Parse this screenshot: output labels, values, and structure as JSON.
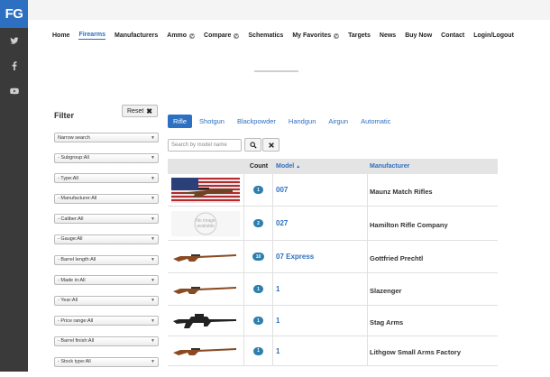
{
  "logo": "FG",
  "social": [
    "twitter-icon",
    "facebook-icon",
    "youtube-icon"
  ],
  "nav": [
    {
      "label": "Home",
      "dropdown": false,
      "active": false
    },
    {
      "label": "Firearms",
      "dropdown": false,
      "active": true
    },
    {
      "label": "Manufacturers",
      "dropdown": false,
      "active": false
    },
    {
      "label": "Ammo",
      "dropdown": true,
      "active": false
    },
    {
      "label": "Compare",
      "dropdown": true,
      "active": false
    },
    {
      "label": "Schematics",
      "dropdown": false,
      "active": false
    },
    {
      "label": "My Favorites",
      "dropdown": true,
      "active": false
    },
    {
      "label": "Targets",
      "dropdown": false,
      "active": false
    },
    {
      "label": "News",
      "dropdown": false,
      "active": false
    },
    {
      "label": "Buy Now",
      "dropdown": false,
      "active": false
    },
    {
      "label": "Contact",
      "dropdown": false,
      "active": false
    },
    {
      "label": "Login/Logout",
      "dropdown": false,
      "active": false
    }
  ],
  "filter": {
    "title": "Filter",
    "reset_label": "Reset",
    "selects": [
      "Narrow search",
      "- Subgroup:All",
      "- Type:All",
      "- Manufacturer:All",
      "- Caliber:All",
      "- Gauge:All",
      "- Barrel length:All",
      "- Made in:All",
      "- Year:All",
      "- Price range:All",
      "- Barrel finish:All",
      "- Stock type:All"
    ]
  },
  "tabs": [
    {
      "label": "Rifle",
      "active": true
    },
    {
      "label": "Shotgun",
      "active": false
    },
    {
      "label": "Blackpowder",
      "active": false
    },
    {
      "label": "Handgun",
      "active": false
    },
    {
      "label": "Airgun",
      "active": false
    },
    {
      "label": "Automatic",
      "active": false
    }
  ],
  "search": {
    "placeholder": "Search by model name"
  },
  "table": {
    "headers": {
      "count": "Count",
      "model": "Model",
      "manufacturer": "Manufacturer"
    },
    "rows": [
      {
        "thumb": "flag-rifle",
        "count": "1",
        "model": "007",
        "manufacturer": "Maunz Match Rifles"
      },
      {
        "thumb": "no-image",
        "count": "2",
        "model": "027",
        "manufacturer": "Hamilton Rifle Company",
        "no_image_text": "No image available"
      },
      {
        "thumb": "wood-rifle",
        "count": "10",
        "model": "07 Express",
        "manufacturer": "Gottfried Prechtl"
      },
      {
        "thumb": "wood-rifle",
        "count": "1",
        "model": "1",
        "manufacturer": "Slazenger"
      },
      {
        "thumb": "black-rifle",
        "count": "1",
        "model": "1",
        "manufacturer": "Stag Arms"
      },
      {
        "thumb": "wood-rifle",
        "count": "1",
        "model": "1",
        "manufacturer": "Lithgow Small Arms Factory"
      }
    ]
  },
  "colors": {
    "accent": "#2d6fc0",
    "badge": "#2e7fae",
    "rail": "#3a3a3a"
  }
}
